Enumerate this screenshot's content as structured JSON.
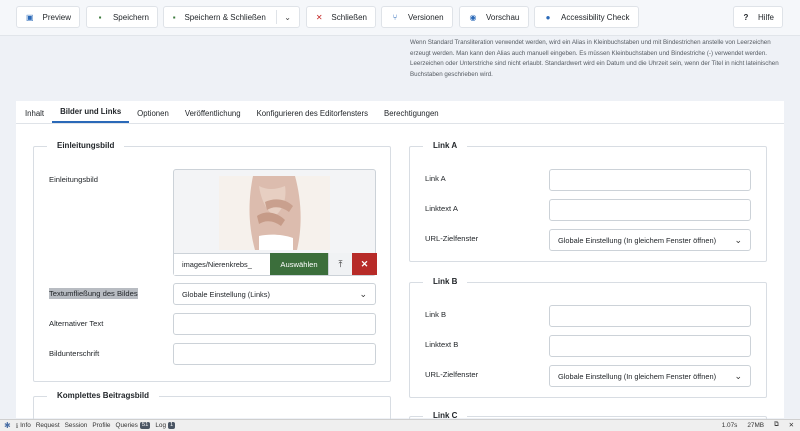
{
  "toolbar": {
    "preview": "Preview",
    "save": "Speichern",
    "save_close": "Speichern & Schließen",
    "close": "Schließen",
    "versions": "Versionen",
    "preview2": "Vorschau",
    "a11y": "Accessibility Check",
    "help": "Hilfe"
  },
  "info_text": "Wenn Standard Transliteration verwendet werden, wird ein Alias in Kleinbuchstaben und mit Bindestrichen anstelle von Leerzeichen erzeugt werden. Man kann den Alias auch manuell eingeben. Es müssen Kleinbuchstaben und Bindestriche (-) verwendet werden. Leerzeichen oder Unterstriche sind nicht erlaubt. Standardwert wird ein Datum und die Uhrzeit sein, wenn der Titel in nicht lateinischen Buchstaben geschrieben wird.",
  "tabs": [
    "Inhalt",
    "Bilder und Links",
    "Optionen",
    "Veröffentlichung",
    "Konfigurieren des Editorfensters",
    "Berechtigungen"
  ],
  "intro": {
    "legend": "Einleitungsbild",
    "image_label": "Einleitungsbild",
    "image_path": "images/Nierenkrebs_",
    "select_btn": "Auswählen",
    "float_label": "Textumfließung des Bildes",
    "float_value": "Globale Einstellung (Links)",
    "alt_label": "Alternativer Text",
    "caption_label": "Bildunterschrift"
  },
  "full": {
    "legend": "Komplettes Beitragsbild"
  },
  "link_a": {
    "legend": "Link A",
    "link_label": "Link A",
    "text_label": "Linktext A",
    "target_label": "URL-Zielfenster",
    "target_value": "Globale Einstellung (In gleichem Fenster öffnen)"
  },
  "link_b": {
    "legend": "Link B",
    "link_label": "Link B",
    "text_label": "Linktext B",
    "target_label": "URL-Zielfenster",
    "target_value": "Globale Einstellung (In gleichem Fenster öffnen)"
  },
  "link_c": {
    "legend": "Link C"
  },
  "debug": {
    "info": "Info",
    "request": "Request",
    "session": "Session",
    "profile": "Profile",
    "queries": "Queries",
    "queries_count": "51",
    "log": "Log",
    "log_count": "1",
    "time": "1.07s",
    "memory": "27MB"
  }
}
